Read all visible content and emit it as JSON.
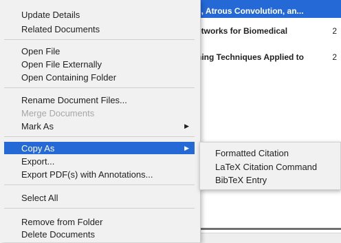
{
  "background_list": {
    "rows": [
      {
        "title": "s, Atrous Convolution, an...",
        "year": "",
        "selected": true
      },
      {
        "title": "etworks for Biomedical",
        "year": "2",
        "selected": false
      },
      {
        "title": "ning Techniques Applied to",
        "year": "2",
        "selected": false
      }
    ]
  },
  "context_menu": {
    "items": [
      {
        "label": "Update Details",
        "disabled": false,
        "submenu": false
      },
      {
        "label": "Related Documents",
        "disabled": false,
        "submenu": false
      },
      {
        "label": "Open File",
        "disabled": false,
        "submenu": false
      },
      {
        "label": "Open File Externally",
        "disabled": false,
        "submenu": false
      },
      {
        "label": "Open Containing Folder",
        "disabled": false,
        "submenu": false
      },
      {
        "label": "Rename Document Files...",
        "disabled": false,
        "submenu": false
      },
      {
        "label": "Merge Documents",
        "disabled": true,
        "submenu": false
      },
      {
        "label": "Mark As",
        "disabled": false,
        "submenu": true
      },
      {
        "label": "Copy As",
        "disabled": false,
        "submenu": true,
        "highlighted": true
      },
      {
        "label": "Export...",
        "disabled": false,
        "submenu": false
      },
      {
        "label": "Export PDF(s) with Annotations...",
        "disabled": false,
        "submenu": false
      },
      {
        "label": "Select All",
        "disabled": false,
        "submenu": false
      },
      {
        "label": "Remove from Folder",
        "disabled": false,
        "submenu": false
      },
      {
        "label": "Delete Documents",
        "disabled": false,
        "submenu": false
      }
    ],
    "submenu_arrow_icon": "triangle-right-icon",
    "highlight_color": "#2569d6"
  },
  "copy_as_submenu": {
    "items": [
      {
        "label": "Formatted Citation"
      },
      {
        "label": "LaTeX Citation Command"
      },
      {
        "label": "BibTeX Entry"
      }
    ]
  }
}
